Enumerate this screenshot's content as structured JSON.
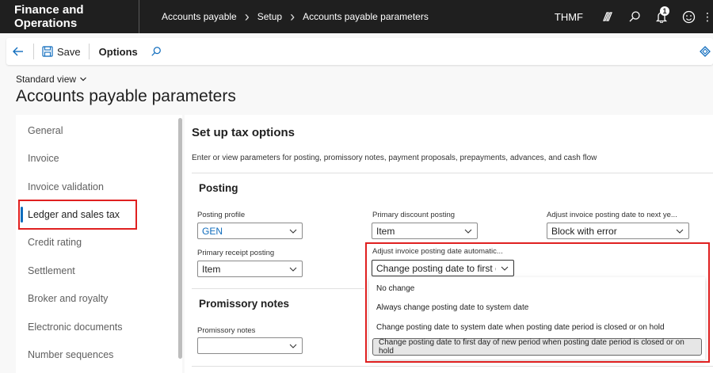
{
  "header": {
    "app_name": "Finance and Operations",
    "breadcrumbs": [
      "Accounts payable",
      "Setup",
      "Accounts payable parameters"
    ],
    "company": "THMF",
    "notification_count": "1"
  },
  "toolbar": {
    "save_label": "Save",
    "options_label": "Options"
  },
  "page": {
    "view_label": "Standard view",
    "title": "Accounts payable parameters"
  },
  "nav": {
    "items": [
      {
        "label": "General"
      },
      {
        "label": "Invoice"
      },
      {
        "label": "Invoice validation"
      },
      {
        "label": "Ledger and sales tax"
      },
      {
        "label": "Credit rating"
      },
      {
        "label": "Settlement"
      },
      {
        "label": "Broker and royalty"
      },
      {
        "label": "Electronic documents"
      },
      {
        "label": "Number sequences"
      }
    ],
    "selected_index": 3
  },
  "main": {
    "title": "Set up tax options",
    "description": "Enter or view parameters for posting, promissory notes, payment proposals, prepayments, advances, and cash flow",
    "posting": {
      "heading": "Posting",
      "posting_profile_label": "Posting profile",
      "posting_profile_value": "GEN",
      "primary_discount_label": "Primary discount posting",
      "primary_discount_value": "Item",
      "adjust_next_year_label": "Adjust invoice posting date to next ye...",
      "adjust_next_year_value": "Block with error",
      "primary_receipt_label": "Primary receipt posting",
      "primary_receipt_value": "Item",
      "adjust_auto_label": "Adjust invoice posting date automatic...",
      "adjust_auto_value": "Change posting date to first da"
    },
    "promissory": {
      "heading": "Promissory notes",
      "promissory_label": "Promissory notes",
      "promissory_value": ""
    }
  },
  "dropdown": {
    "options": [
      "No change",
      "Always change posting date to system date",
      "Change posting date to system date when posting date period is closed or on hold",
      "Change posting date to first day of new period when posting date period is closed or on hold"
    ],
    "selected_index": 3
  },
  "colors": {
    "header_bg": "#1f1f1f",
    "accent": "#0f6cbd",
    "highlight_red": "#e02020"
  }
}
